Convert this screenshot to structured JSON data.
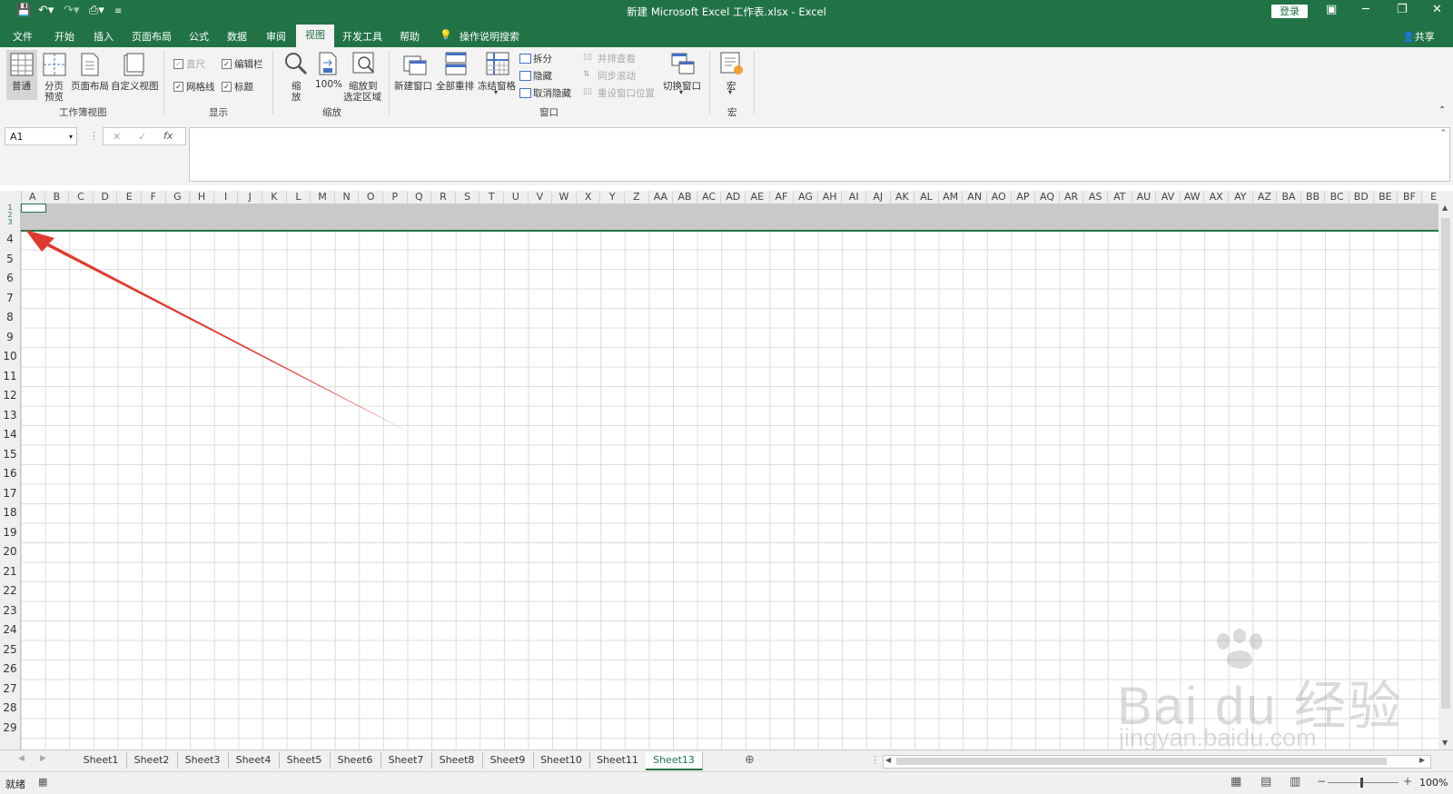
{
  "window": {
    "title": "新建 Microsoft Excel 工作表.xlsx  -  Excel",
    "login_label": "登录",
    "share_label": "共享"
  },
  "tabs": [
    "文件",
    "开始",
    "插入",
    "页面布局",
    "公式",
    "数据",
    "审阅",
    "视图",
    "开发工具",
    "帮助"
  ],
  "active_tab": "视图",
  "tell_me": "操作说明搜索",
  "ribbon": {
    "workbook_views": {
      "group_label": "工作簿视图",
      "normal": "普通",
      "page_break_1": "分页",
      "page_break_2": "预览",
      "page_layout": "页面布局",
      "custom_views": "自定义视图"
    },
    "show": {
      "group_label": "显示",
      "ruler": "直尺",
      "formula_bar": "编辑栏",
      "gridlines": "网格线",
      "headings": "标题"
    },
    "zoom": {
      "group_label": "缩放",
      "zoom_1": "缩",
      "zoom_2": "放",
      "hundred": "100%",
      "zoom_sel_1": "缩放到",
      "zoom_sel_2": "选定区域"
    },
    "window": {
      "group_label": "窗口",
      "new_window": "新建窗口",
      "arrange_all": "全部重排",
      "freeze_panes": "冻结窗格",
      "split": "拆分",
      "hide": "隐藏",
      "unhide": "取消隐藏",
      "side_by_side": "并排查看",
      "sync_scroll": "同步滚动",
      "reset_position": "重设窗口位置",
      "switch_windows": "切换窗口"
    },
    "macros": {
      "group_label": "宏",
      "macros": "宏"
    }
  },
  "formula_bar": {
    "name_box": "A1",
    "fx": "fx",
    "cancel": "✕",
    "enter": "✓"
  },
  "columns": [
    "A",
    "B",
    "C",
    "D",
    "E",
    "F",
    "G",
    "H",
    "I",
    "J",
    "K",
    "L",
    "M",
    "N",
    "O",
    "P",
    "Q",
    "R",
    "S",
    "T",
    "U",
    "V",
    "W",
    "X",
    "Y",
    "Z",
    "AA",
    "AB",
    "AC",
    "AD",
    "AE",
    "AF",
    "AG",
    "AH",
    "AI",
    "AJ",
    "AK",
    "AL",
    "AM",
    "AN",
    "AO",
    "AP",
    "AQ",
    "AR",
    "AS",
    "AT",
    "AU",
    "AV",
    "AW",
    "AX",
    "AY",
    "AZ",
    "BA",
    "BB",
    "BC",
    "BD",
    "BE",
    "BF",
    "E"
  ],
  "rows": [
    "1",
    "2",
    "3",
    "4",
    "5",
    "6",
    "7",
    "8",
    "9",
    "10",
    "11",
    "12",
    "13",
    "14",
    "15",
    "16",
    "17",
    "18",
    "19",
    "20",
    "21",
    "22",
    "23",
    "24",
    "25",
    "26",
    "27",
    "28",
    "29"
  ],
  "sheets": [
    "Sheet1",
    "Sheet2",
    "Sheet3",
    "Sheet4",
    "Sheet5",
    "Sheet6",
    "Sheet7",
    "Sheet8",
    "Sheet9",
    "Sheet10",
    "Sheet11",
    "Sheet13"
  ],
  "active_sheet": "Sheet13",
  "status": {
    "ready": "就绪",
    "zoom": "100%"
  },
  "watermark": {
    "brand": "Bai du 经验",
    "url": "jingyan.baidu.com"
  },
  "colors": {
    "excel_green": "#217346",
    "arrow_red": "#e03a2f"
  }
}
